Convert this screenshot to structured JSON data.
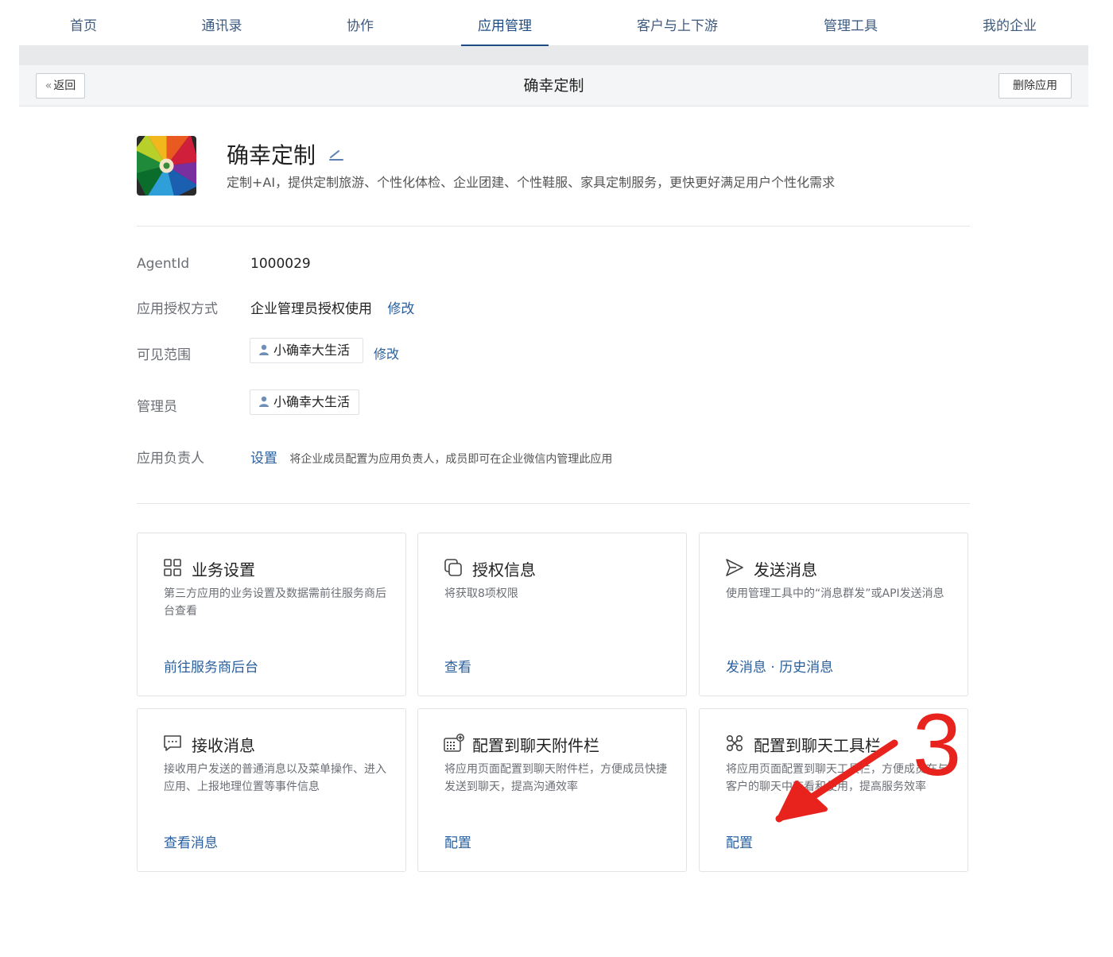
{
  "nav": {
    "tabs": [
      {
        "label": "首页"
      },
      {
        "label": "通讯录"
      },
      {
        "label": "协作"
      },
      {
        "label": "应用管理"
      },
      {
        "label": "客户与上下游"
      },
      {
        "label": "管理工具"
      },
      {
        "label": "我的企业"
      }
    ],
    "active": "应用管理"
  },
  "header": {
    "back_label": "返回",
    "title": "确幸定制",
    "delete_label": "删除应用"
  },
  "app": {
    "name": "确幸定制",
    "description": "定制+AI，提供定制旅游、个性化体检、企业团建、个性鞋服、家具定制服务，更快更好满足用户个性化需求"
  },
  "info": {
    "agentid_label": "AgentId",
    "agentid_value": "1000029",
    "auth_label": "应用授权方式",
    "auth_value": "企业管理员授权使用",
    "auth_edit": "修改",
    "visible_label": "可见范围",
    "visible_value": "小确幸大生活",
    "visible_edit": "修改",
    "admin_label": "管理员",
    "admin_value": "小确幸大生活",
    "owner_label": "应用负责人",
    "owner_link": "设置",
    "owner_hint": "将企业成员配置为应用负责人，成员即可在企业微信内管理此应用"
  },
  "cards": [
    {
      "title": "业务设置",
      "icon": "grid-icon",
      "desc": "第三方应用的业务设置及数据需前往服务商后台查看",
      "links": [
        "前往服务商后台"
      ]
    },
    {
      "title": "授权信息",
      "icon": "copy-icon",
      "desc": "将获取8项权限",
      "links": [
        "查看"
      ]
    },
    {
      "title": "发送消息",
      "icon": "send-icon",
      "desc": "使用管理工具中的“消息群发”或API发送消息",
      "links": [
        "发消息",
        "历史消息"
      ]
    },
    {
      "title": "接收消息",
      "icon": "chat-bubble-icon",
      "desc": "接收用户发送的普通消息以及菜单操作、进入应用、上报地理位置等事件信息",
      "links": [
        "查看消息"
      ]
    },
    {
      "title": "配置到聊天附件栏",
      "icon": "keyboard-add-icon",
      "desc": "将应用页面配置到聊天附件栏，方便成员快捷发送到聊天，提高沟通效率",
      "links": [
        "配置"
      ]
    },
    {
      "title": "配置到聊天工具栏",
      "icon": "tools-icon",
      "desc": "将应用页面配置到聊天工具栏，方便成员在与客户的聊天中查看和使用，提高服务效率",
      "links": [
        "配置"
      ]
    }
  ],
  "annotation": {
    "number": "3",
    "color": "#e8231d"
  },
  "colors": {
    "link": "#2a5f9e",
    "nav_active": "#1e4d86",
    "header_bg": "#f4f5f6"
  }
}
